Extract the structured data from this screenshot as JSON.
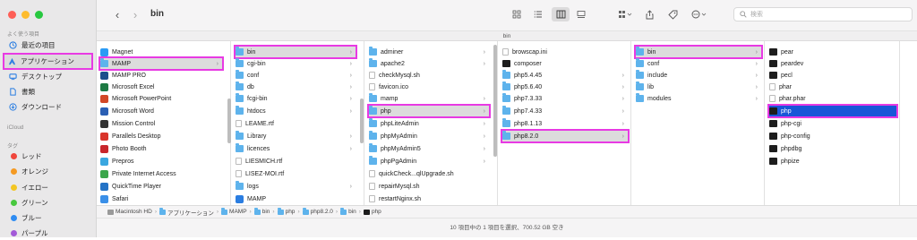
{
  "window": {
    "title": "bin",
    "path_header": "bin",
    "search_placeholder": "検索"
  },
  "sidebar": {
    "favorites_header": "よく使う項目",
    "favorites": [
      {
        "label": "最近の項目",
        "icon": "clock-icon",
        "selected": false
      },
      {
        "label": "アプリケーション",
        "icon": "applications-icon",
        "selected": true
      },
      {
        "label": "デスクトップ",
        "icon": "desktop-icon",
        "selected": false
      },
      {
        "label": "書類",
        "icon": "document-icon",
        "selected": false
      },
      {
        "label": "ダウンロード",
        "icon": "download-icon",
        "selected": false
      }
    ],
    "icloud_header": "iCloud",
    "tags_header": "タグ",
    "tags": [
      {
        "label": "レッド",
        "color": "#f0463c"
      },
      {
        "label": "オレンジ",
        "color": "#f59a23"
      },
      {
        "label": "イエロー",
        "color": "#f3c623"
      },
      {
        "label": "グリーン",
        "color": "#48c83e"
      },
      {
        "label": "ブルー",
        "color": "#2f8cf2"
      },
      {
        "label": "パープル",
        "color": "#a35ad8"
      }
    ]
  },
  "columns": [
    {
      "items": [
        {
          "label": "Magnet",
          "icon": "magnet-app-icon",
          "color": "#2a9bf5",
          "kind": "app"
        },
        {
          "label": "MAMP",
          "icon": "folder-icon",
          "kind": "folder",
          "selected": true,
          "highlight": true,
          "chevron": true
        },
        {
          "label": "MAMP PRO",
          "icon": "mamp-pro-app-icon",
          "color": "#1d4f8c",
          "kind": "app"
        },
        {
          "label": "Microsoft Excel",
          "icon": "excel-app-icon",
          "color": "#1e7a44",
          "kind": "app"
        },
        {
          "label": "Microsoft PowerPoint",
          "icon": "powerpoint-app-icon",
          "color": "#d24726",
          "kind": "app"
        },
        {
          "label": "Microsoft Word",
          "icon": "word-app-icon",
          "color": "#2b5fb4",
          "kind": "app"
        },
        {
          "label": "Mission Control",
          "icon": "mission-control-app-icon",
          "color": "#333333",
          "kind": "app"
        },
        {
          "label": "Parallels Desktop",
          "icon": "parallels-app-icon",
          "color": "#d9342b",
          "kind": "app"
        },
        {
          "label": "Photo Booth",
          "icon": "photo-booth-app-icon",
          "color": "#c8262b",
          "kind": "app"
        },
        {
          "label": "Prepros",
          "icon": "prepros-app-icon",
          "color": "#3aa7e0",
          "kind": "app"
        },
        {
          "label": "Private Internet Access",
          "icon": "pia-app-icon",
          "color": "#3ba64b",
          "kind": "app"
        },
        {
          "label": "QuickTime Player",
          "icon": "quicktime-app-icon",
          "color": "#2473c6",
          "kind": "app"
        },
        {
          "label": "Safari",
          "icon": "safari-app-icon",
          "color": "#3a8fe8",
          "kind": "app"
        }
      ]
    },
    {
      "items": [
        {
          "label": "bin",
          "kind": "folder",
          "selected": true,
          "highlight": true,
          "chevron": true
        },
        {
          "label": "cgi-bin",
          "kind": "folder",
          "chevron": true
        },
        {
          "label": "conf",
          "kind": "folder",
          "chevron": true
        },
        {
          "label": "db",
          "kind": "folder",
          "chevron": true
        },
        {
          "label": "fcgi-bin",
          "kind": "folder",
          "chevron": true
        },
        {
          "label": "htdocs",
          "kind": "folder",
          "chevron": true
        },
        {
          "label": "LEAME.rtf",
          "kind": "doc"
        },
        {
          "label": "Library",
          "kind": "folder",
          "chevron": true
        },
        {
          "label": "licences",
          "kind": "folder",
          "chevron": true
        },
        {
          "label": "LIESMICH.rtf",
          "kind": "doc"
        },
        {
          "label": "LISEZ-MOI.rtf",
          "kind": "doc"
        },
        {
          "label": "logs",
          "kind": "folder",
          "chevron": true
        },
        {
          "label": "MAMP",
          "kind": "app"
        }
      ]
    },
    {
      "items": [
        {
          "label": "adminer",
          "kind": "folder",
          "chevron": true
        },
        {
          "label": "apache2",
          "kind": "folder",
          "chevron": true
        },
        {
          "label": "checkMysql.sh",
          "kind": "doc"
        },
        {
          "label": "favicon.ico",
          "kind": "doc"
        },
        {
          "label": "mamp",
          "kind": "folder",
          "chevron": true
        },
        {
          "label": "php",
          "kind": "folder",
          "selected": true,
          "highlight": true,
          "chevron": true
        },
        {
          "label": "phpLiteAdmin",
          "kind": "folder",
          "chevron": true
        },
        {
          "label": "phpMyAdmin",
          "kind": "folder",
          "chevron": true
        },
        {
          "label": "phpMyAdmin5",
          "kind": "folder",
          "chevron": true
        },
        {
          "label": "phpPgAdmin",
          "kind": "folder",
          "chevron": true
        },
        {
          "label": "quickCheck...qlUpgrade.sh",
          "kind": "doc"
        },
        {
          "label": "repairMysql.sh",
          "kind": "doc"
        },
        {
          "label": "restartNginx.sh",
          "kind": "doc"
        }
      ]
    },
    {
      "items": [
        {
          "label": "browscap.ini",
          "kind": "doc"
        },
        {
          "label": "composer",
          "kind": "exec"
        },
        {
          "label": "php5.4.45",
          "kind": "folder",
          "chevron": true
        },
        {
          "label": "php5.6.40",
          "kind": "folder",
          "chevron": true
        },
        {
          "label": "php7.3.33",
          "kind": "folder",
          "chevron": true
        },
        {
          "label": "php7.4.33",
          "kind": "folder",
          "chevron": true
        },
        {
          "label": "php8.1.13",
          "kind": "folder",
          "chevron": true
        },
        {
          "label": "php8.2.0",
          "kind": "folder",
          "selected": true,
          "highlight": true,
          "chevron": true
        }
      ]
    },
    {
      "items": [
        {
          "label": "bin",
          "kind": "folder",
          "selected": true,
          "highlight": true,
          "chevron": true
        },
        {
          "label": "conf",
          "kind": "folder",
          "chevron": true
        },
        {
          "label": "include",
          "kind": "folder",
          "chevron": true
        },
        {
          "label": "lib",
          "kind": "folder",
          "chevron": true
        },
        {
          "label": "modules",
          "kind": "folder",
          "chevron": true
        }
      ]
    },
    {
      "items": [
        {
          "label": "pear",
          "kind": "exec"
        },
        {
          "label": "peardev",
          "kind": "exec"
        },
        {
          "label": "pecl",
          "kind": "exec"
        },
        {
          "label": "phar",
          "kind": "doc"
        },
        {
          "label": "phar.phar",
          "kind": "doc"
        },
        {
          "label": "php",
          "kind": "exec",
          "active": true,
          "highlight": true
        },
        {
          "label": "php-cgi",
          "kind": "exec"
        },
        {
          "label": "php-config",
          "kind": "exec"
        },
        {
          "label": "phpdbg",
          "kind": "exec"
        },
        {
          "label": "phpize",
          "kind": "exec"
        }
      ]
    }
  ],
  "pathbar": [
    {
      "label": "Macintosh HD",
      "kind": "disk"
    },
    {
      "label": "アプリケーション",
      "kind": "folder"
    },
    {
      "label": "MAMP",
      "kind": "folder"
    },
    {
      "label": "bin",
      "kind": "folder"
    },
    {
      "label": "php",
      "kind": "folder"
    },
    {
      "label": "php8.2.0",
      "kind": "folder"
    },
    {
      "label": "bin",
      "kind": "folder"
    },
    {
      "label": "php",
      "kind": "exec"
    }
  ],
  "status": "10 項目中の 1 項目を選択、700.52 GB 空き"
}
